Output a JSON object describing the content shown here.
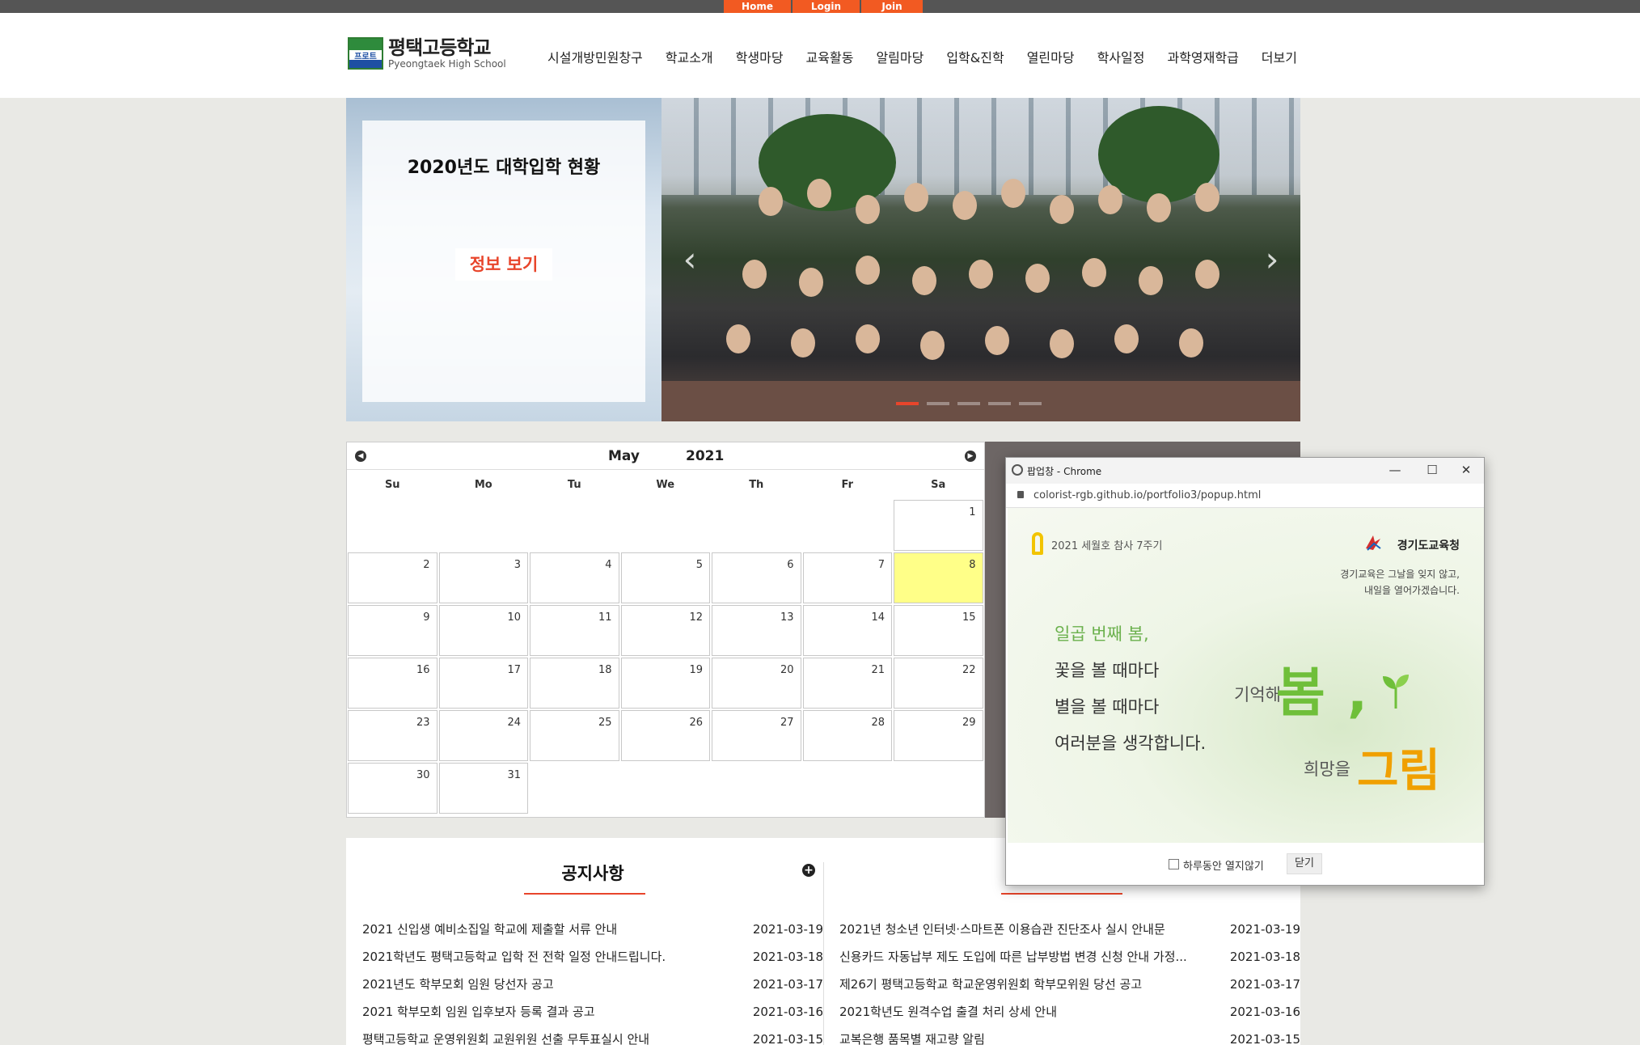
{
  "topbar": {
    "tabs": [
      "Home",
      "Login",
      "Join"
    ]
  },
  "header": {
    "logo_mark": "프로트",
    "school_name_ko": "평택고등학교",
    "school_name_en": "Pyeongtaek High School",
    "nav": [
      "시설개방민원창구",
      "학교소개",
      "학생마당",
      "교육활동",
      "알림마당",
      "입학&진학",
      "열린마당",
      "학사일정",
      "과학영재학급",
      "더보기"
    ]
  },
  "hero": {
    "card_title": "2020년도 대학입학 현황",
    "card_button": "정보 보기",
    "prev_icon": "‹",
    "next_icon": "›"
  },
  "calendar": {
    "month": "May",
    "year": "2021",
    "weekdays": [
      "Su",
      "Mo",
      "Tu",
      "We",
      "Th",
      "Fr",
      "Sa"
    ],
    "today": "8",
    "leading_blanks": 6,
    "days": [
      "1",
      "2",
      "3",
      "4",
      "5",
      "6",
      "7",
      "8",
      "9",
      "10",
      "11",
      "12",
      "13",
      "14",
      "15",
      "16",
      "17",
      "18",
      "19",
      "20",
      "21",
      "22",
      "23",
      "24",
      "25",
      "26",
      "27",
      "28",
      "29",
      "30",
      "31"
    ]
  },
  "notices": {
    "left": {
      "title": "공지사항",
      "items": [
        {
          "title": "2021 신입생 예비소집일 학교에 제출할 서류 안내",
          "date": "2021-03-19"
        },
        {
          "title": "2021학년도 평택고등학교 입학 전 전학 일정 안내드립니다.",
          "date": "2021-03-18"
        },
        {
          "title": "2021년도 학부모회 임원 당선자 공고",
          "date": "2021-03-17"
        },
        {
          "title": "2021 학부모회 임원 입후보자 등록 결과 공고",
          "date": "2021-03-16"
        },
        {
          "title": "평택고등학교 운영위원회 교원위원 선출 무투표실시 안내",
          "date": "2021-03-15"
        }
      ]
    },
    "right": {
      "title": "",
      "items": [
        {
          "title": "2021년 청소년 인터넷·스마트폰 이용습관 진단조사 실시 안내문",
          "date": "2021-03-19"
        },
        {
          "title": "신용카드 자동납부 제도 도입에 따른 납부방법 변경 신청 안내 가정...",
          "date": "2021-03-18"
        },
        {
          "title": "제26기 평택고등학교 학교운영위원회 학부모위원 당선 공고",
          "date": "2021-03-17"
        },
        {
          "title": "2021학년도 원격수업 출결 처리 상세 안내",
          "date": "2021-03-16"
        },
        {
          "title": "교복은행 품목별 재고량 알림",
          "date": "2021-03-15"
        }
      ]
    }
  },
  "popup": {
    "window_title": "팝업창 - Chrome",
    "url": "colorist-rgb.github.io/portfolio3/popup.html",
    "ribbon_text": "2021 세월호 참사 7주기",
    "gov_name": "경기도교육청",
    "gov_message_1": "경기교육은 그날을 잊지 않고,",
    "gov_message_2": "내일을 열어가겠습니다.",
    "poem": [
      "일곱 번째 봄,",
      "꽃을 볼 때마다",
      "별을 볼 때마다",
      "여러분을 생각합니다."
    ],
    "remember_label": "기억해",
    "spring_word": "봄",
    "hope_label": "희망을",
    "draw_word": "그림",
    "dont_show_label": "하루동안 열지않기",
    "close_label": "닫기",
    "accent_green": "#6ab04c",
    "accent_orange": "#f0a000"
  },
  "colors": {
    "brand_orange": "#f25a22",
    "topbar": "#555555",
    "today_highlight": "#ffff88"
  }
}
